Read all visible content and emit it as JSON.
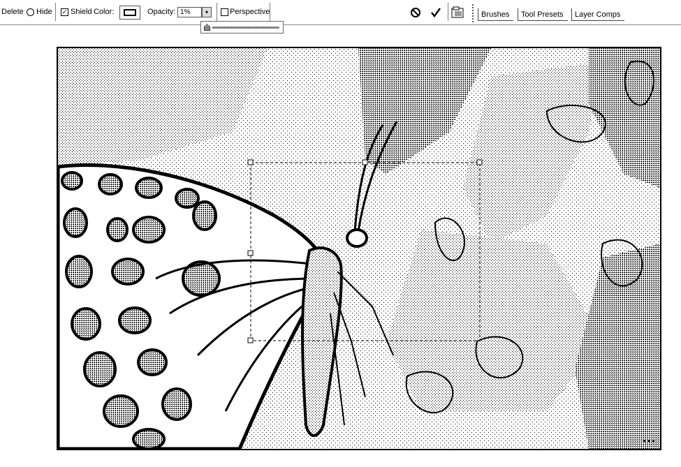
{
  "toolbar": {
    "delete_label": "Delete",
    "hide_label": "Hide",
    "shield_label": "Shield",
    "shield_checked": true,
    "color_label": "Color:",
    "opacity_label": "Opacity:",
    "opacity_value": "1%",
    "perspective_label": "Perspective",
    "perspective_checked": false,
    "opacity_slider_value": 0.01
  },
  "palette_tabs": [
    "Brushes",
    "Tool Presets",
    "Layer Comps"
  ],
  "icons": {
    "cancel": "cancel-icon",
    "commit": "checkmark-icon",
    "palette_well": "palette-well-icon",
    "opacity_arrow": "chevron-down-icon"
  },
  "canvas": {
    "image_description_tag": "butterfly-on-flower",
    "corner_label": "▪▪▪"
  },
  "colors": {
    "shield_color": "#000000",
    "toolbar_background": "#ffffff",
    "canvas_border": "#000000"
  }
}
